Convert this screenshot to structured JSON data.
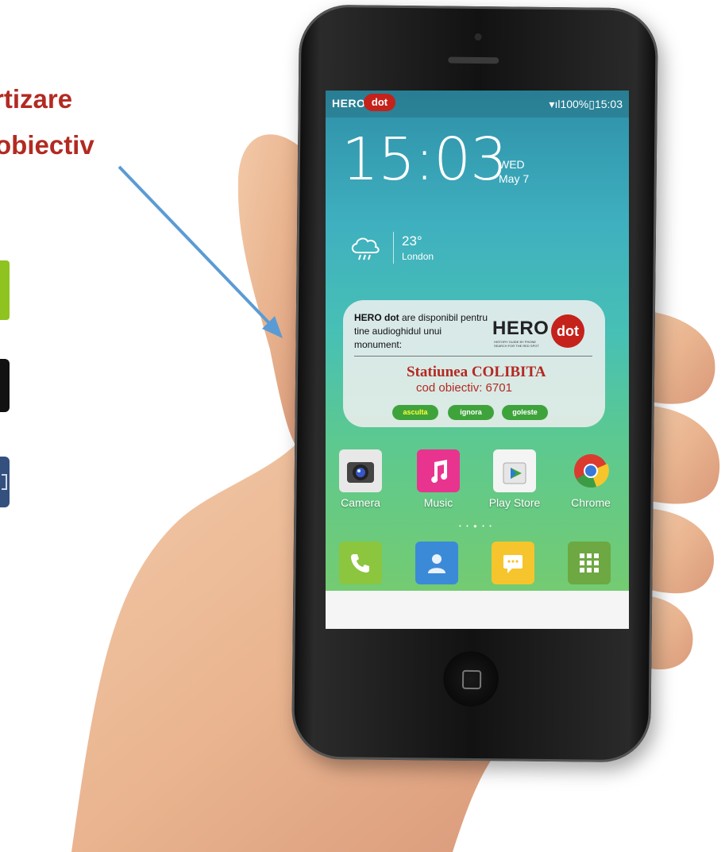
{
  "caption": {
    "line1": "rtizare",
    "line2": "obiectiv"
  },
  "colors": {
    "caption": "#b22a22",
    "accent_red": "#c4221b",
    "button_green": "#3fa33c"
  },
  "status_bar": {
    "brand": "HERO",
    "brand_dot": "dot",
    "indicators": "▾ıl100%▯15:03"
  },
  "lockscreen": {
    "time": "15:03",
    "day": "WED",
    "date": "May 7",
    "weather_icon": "cloud-rain-icon",
    "temperature": "23°",
    "city": "London"
  },
  "notification": {
    "brand": "HERO",
    "brand_suffix": " dot",
    "message_rest": " are disponibil pentru tine audioghidul unui monument:",
    "logo_text": "HERO",
    "logo_dot": "dot",
    "logo_tagline": "HISTORY GUIDE BY PHONE SEARCH FOR THE RED SPOT",
    "title": "Statiunea COLIBITA",
    "code": "cod obiectiv: 6701",
    "buttons": [
      "asculta",
      "ignora",
      "goleste"
    ]
  },
  "apps": [
    {
      "label": "Camera",
      "icon": "camera-icon"
    },
    {
      "label": "Music",
      "icon": "music-icon"
    },
    {
      "label": "Play Store",
      "icon": "play-store-icon"
    },
    {
      "label": "Chrome",
      "icon": "chrome-icon"
    }
  ],
  "page_dots": "• • ● • •",
  "dock": [
    {
      "icon": "phone-icon"
    },
    {
      "icon": "contacts-icon"
    },
    {
      "icon": "messages-icon"
    },
    {
      "icon": "app-drawer-icon"
    }
  ]
}
